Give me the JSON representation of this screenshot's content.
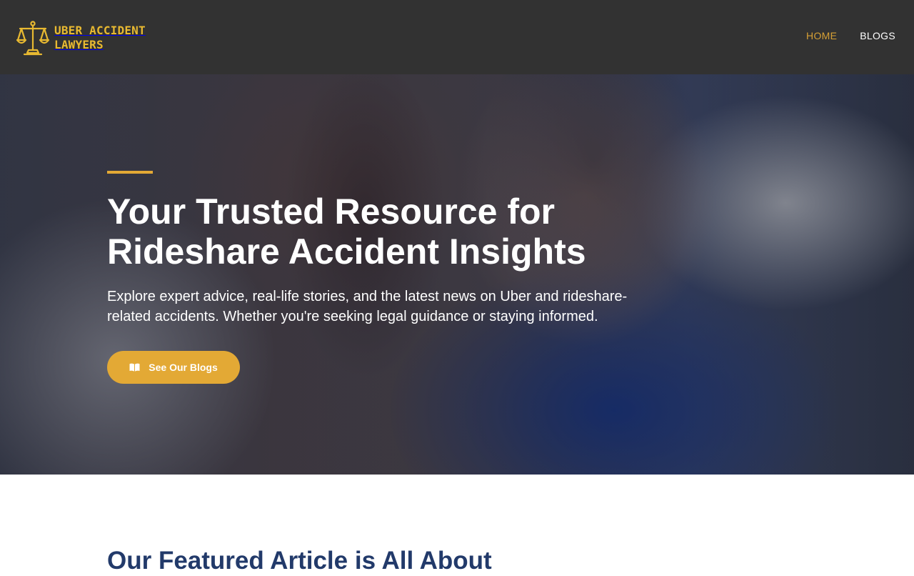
{
  "brand": {
    "line1": "UBER ACCIDENT",
    "line2": "LAWYERS",
    "color": "#e8b931",
    "logo_icon": "scales-of-justice-icon"
  },
  "nav": {
    "home": "HOME",
    "blogs": "BLOGS",
    "active_color": "#d6a035"
  },
  "hero": {
    "title": "Your Trusted Resource for Rideshare Accident Insights",
    "subtitle": "Explore expert advice, real-life stories, and the latest news on Uber and rideshare-related accidents. Whether you're seeking legal guidance or staying informed.",
    "cta_label": "See Our Blogs",
    "cta_icon": "open-book-icon",
    "accent_color": "#e3a935"
  },
  "featured": {
    "heading": "Our Featured Article is All About"
  }
}
